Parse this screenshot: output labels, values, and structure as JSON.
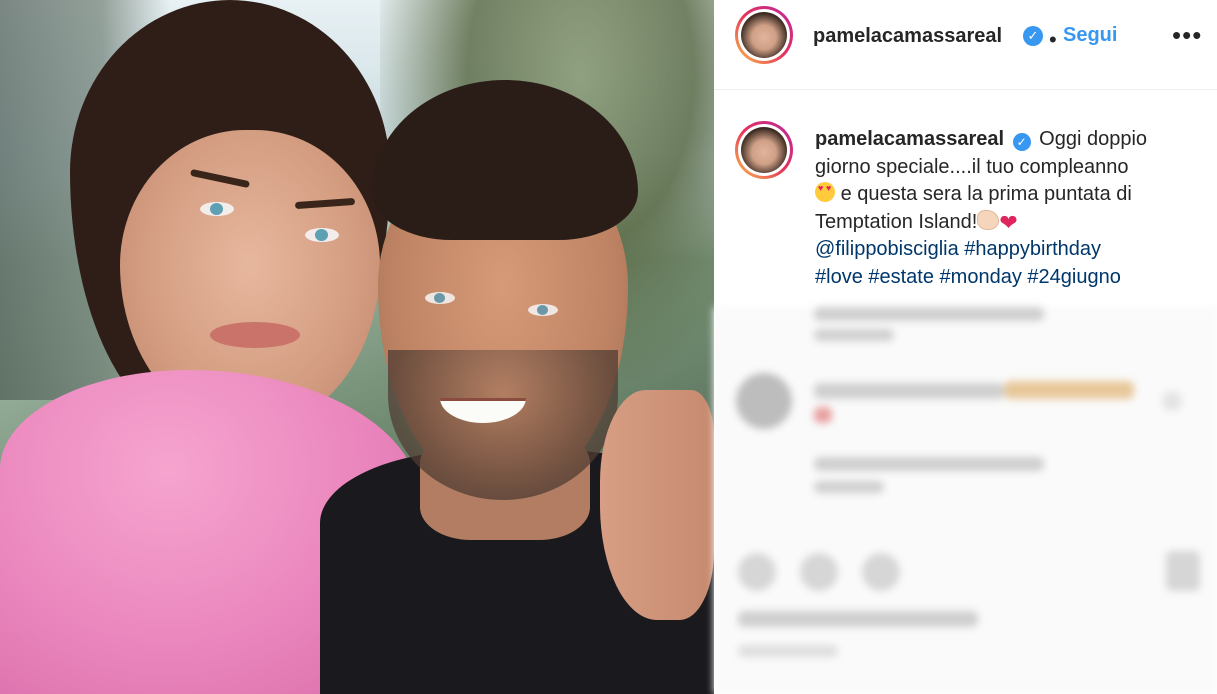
{
  "post": {
    "username": "pamelacamassareal",
    "verified_icon": "verified-badge-icon",
    "separator": "•",
    "follow_label": "Segui",
    "more_icon": "more-options-icon",
    "more_glyph": "•••"
  },
  "caption": {
    "username": "pamelacamassareal",
    "line1": "Oggi doppio",
    "line2": "giorno speciale....il tuo compleanno",
    "line3": "e questa sera la prima puntata di",
    "line4": "Temptation Island!",
    "mention": "@filippobisciglia",
    "hashtags_line1": "#happybirthday",
    "hashtags": [
      "#love",
      "#estate",
      "#monday",
      "#24giugno"
    ]
  },
  "colors": {
    "link": "#00376b",
    "follow": "#3897f0",
    "verified": "#3897f0",
    "text": "#262626"
  }
}
